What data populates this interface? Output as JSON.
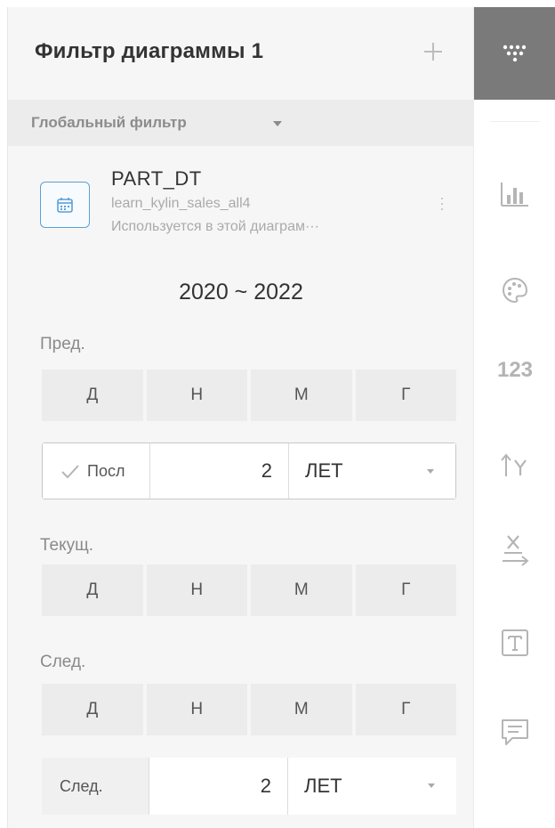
{
  "panel": {
    "title": "Фильтр диаграммы  1",
    "add_icon": "plus-icon",
    "global_filter_label": "Глобальный фильтр"
  },
  "field": {
    "name": "PART_DT",
    "source": "learn_kylin_sales_all4",
    "usage": "Используется в этой диаграм···",
    "icon": "calendar-icon"
  },
  "range": "2020 ~ 2022",
  "previous": {
    "label": "Пред.",
    "buttons": [
      "Д",
      "Н",
      "М",
      "Г"
    ],
    "last_label": "Посл",
    "last_value": "2",
    "last_unit": "ЛЕТ",
    "checked": true
  },
  "current": {
    "label": "Текущ.",
    "buttons": [
      "Д",
      "Н",
      "М",
      "Г"
    ]
  },
  "next": {
    "label": "След.",
    "buttons": [
      "Д",
      "Н",
      "М",
      "Г"
    ],
    "next_label": "След.",
    "next_value": "2",
    "next_unit": "ЛЕТ"
  },
  "rail": {
    "items": [
      "filter-icon",
      "bar-chart-icon",
      "palette-icon",
      "number-format-icon",
      "y-axis-icon",
      "x-axis-icon",
      "text-icon",
      "comment-icon"
    ],
    "number_format_label": "123"
  },
  "colors": {
    "accent": "#5aa0d8",
    "rail_active": "#7a7a7a",
    "panel_bg": "#f6f6f6"
  }
}
